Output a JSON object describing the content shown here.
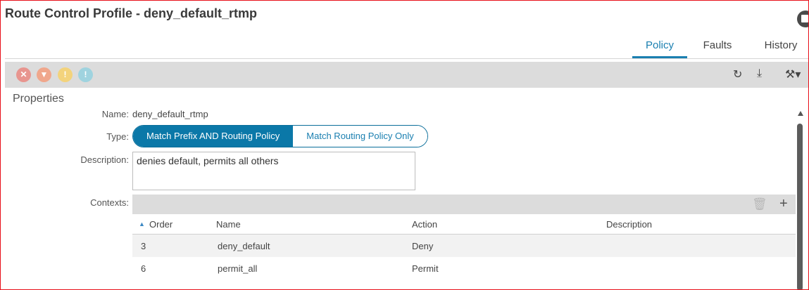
{
  "header": {
    "title": "Route Control Profile - deny_default_rtmp"
  },
  "tabs": [
    {
      "label": "Policy",
      "active": true
    },
    {
      "label": "Faults",
      "active": false
    },
    {
      "label": "History",
      "active": false
    }
  ],
  "toolbar": {
    "fault_icons": [
      {
        "name": "critical-fault-icon",
        "glyph": "✕",
        "color": "#e8958f"
      },
      {
        "name": "major-fault-icon",
        "glyph": "▼",
        "color": "#f0a78c"
      },
      {
        "name": "minor-fault-icon",
        "glyph": "!",
        "color": "#f3d37c"
      },
      {
        "name": "warning-fault-icon",
        "glyph": "!",
        "color": "#9fd3df"
      }
    ],
    "right_icons": [
      {
        "name": "refresh-icon",
        "glyph": "↻"
      },
      {
        "name": "download-icon",
        "glyph": "⤓"
      },
      {
        "name": "tools-icon",
        "glyph": "⚒▾"
      }
    ]
  },
  "properties": {
    "section_title": "Properties",
    "name_label": "Name:",
    "name_value": "deny_default_rtmp",
    "type_label": "Type:",
    "type_options": [
      {
        "label": "Match Prefix AND Routing Policy",
        "selected": true
      },
      {
        "label": "Match Routing Policy Only",
        "selected": false
      }
    ],
    "description_label": "Description:",
    "description_value": "denies default, permits all others",
    "contexts_label": "Contexts:"
  },
  "contexts_table": {
    "toolbar_icons": [
      {
        "name": "trash-icon",
        "glyph": "🗑"
      },
      {
        "name": "add-icon",
        "glyph": "+"
      }
    ],
    "sort_indicator": "▲",
    "columns": [
      "Order",
      "Name",
      "Action",
      "Description"
    ],
    "rows": [
      {
        "order": "3",
        "name": "deny_default",
        "action": "Deny",
        "description": ""
      },
      {
        "order": "6",
        "name": "permit_all",
        "action": "Permit",
        "description": ""
      }
    ]
  }
}
